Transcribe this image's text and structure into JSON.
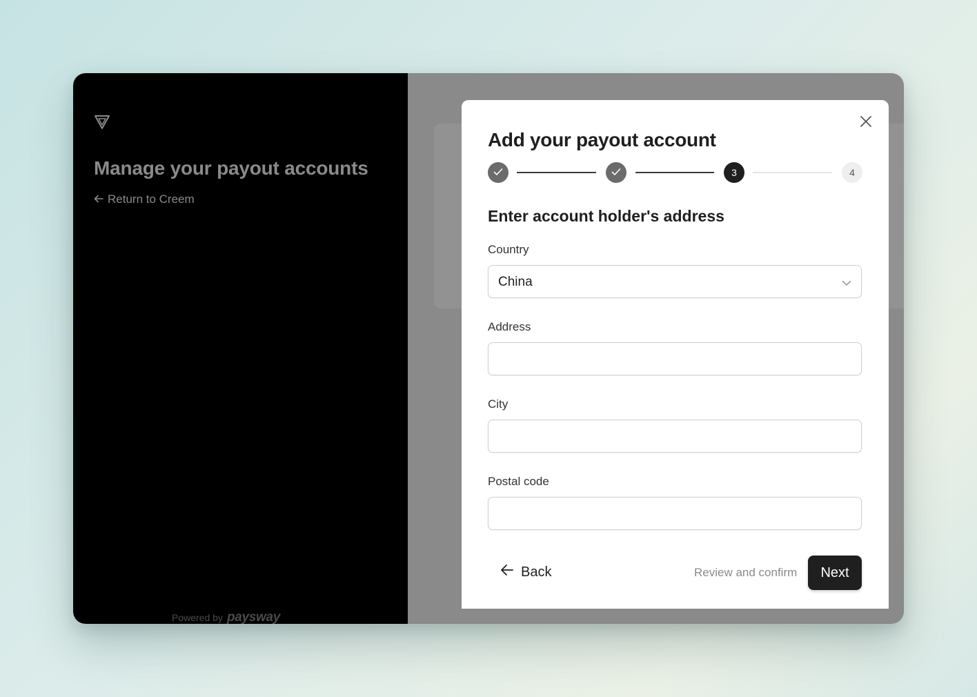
{
  "sidebar": {
    "title": "Manage your payout accounts",
    "return_link": "Return to Creem",
    "powered_by_label": "Powered by",
    "powered_by_brand": "paysway"
  },
  "modal": {
    "title": "Add your payout account",
    "stepper": {
      "steps": [
        {
          "label": "",
          "state": "done"
        },
        {
          "label": "",
          "state": "done"
        },
        {
          "label": "3",
          "state": "current"
        },
        {
          "label": "4",
          "state": "pending"
        }
      ]
    },
    "section_title": "Enter account holder's address",
    "fields": {
      "country": {
        "label": "Country",
        "value": "China"
      },
      "address": {
        "label": "Address",
        "value": ""
      },
      "city": {
        "label": "City",
        "value": ""
      },
      "postal_code": {
        "label": "Postal code",
        "value": ""
      }
    },
    "footer": {
      "back_label": "Back",
      "review_label": "Review and confirm",
      "next_label": "Next"
    }
  },
  "icons": {
    "logo": "triangle-logo-icon",
    "close": "close-icon",
    "back": "arrow-left-icon",
    "check": "check-icon",
    "chevron": "chevron-down-icon"
  },
  "colors": {
    "primary": "#1f1f1f",
    "overlay": "#8a8a8a",
    "sidebar_bg": "#000000"
  }
}
